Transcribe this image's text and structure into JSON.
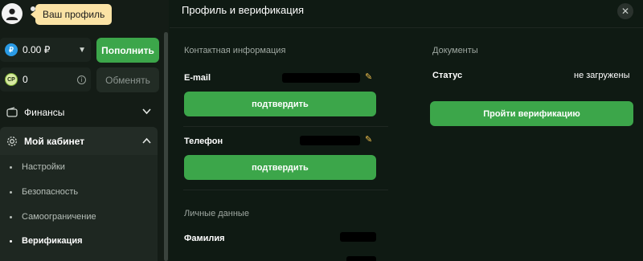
{
  "profile": {
    "tooltip": "Ваш профиль"
  },
  "balances": {
    "rub": {
      "icon": "ruble-coin-icon",
      "glyph": "₽",
      "value": "0.00 ₽"
    },
    "cp": {
      "icon": "cp-coin-icon",
      "glyph": "CP",
      "value": "0"
    }
  },
  "buttons": {
    "topup": "Пополнить",
    "exchange": "Обменять"
  },
  "menu": {
    "finance": "Финансы",
    "cabinet": "Мой кабинет",
    "submenu": [
      {
        "label": "Настройки"
      },
      {
        "label": "Безопасность"
      },
      {
        "label": "Самоограничение"
      },
      {
        "label": "Верификация"
      }
    ]
  },
  "panel": {
    "title": "Профиль и верификация",
    "contact": {
      "heading": "Контактная информация",
      "email_label": "E-mail",
      "phone_label": "Телефон",
      "confirm_label": "подтвердить"
    },
    "personal": {
      "heading": "Личные данные",
      "surname_label": "Фамилия"
    },
    "documents": {
      "heading": "Документы",
      "status_label": "Статус",
      "status_value": "не загружены",
      "verify_button": "Пройти верификацию"
    }
  },
  "colors": {
    "accent_green": "#3ca64a",
    "tooltip_bg": "#fbe3a5",
    "background": "#0f1a13"
  }
}
